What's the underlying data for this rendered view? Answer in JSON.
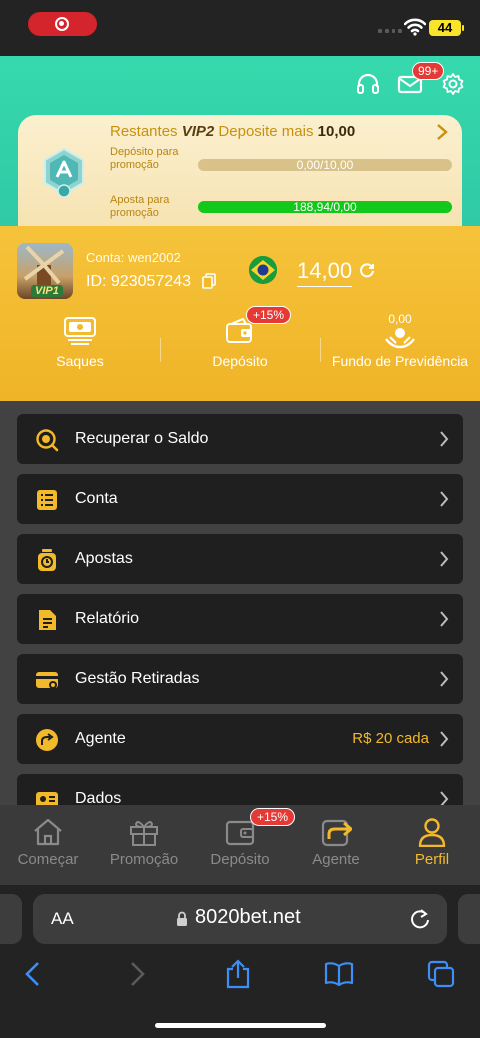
{
  "status": {
    "battery": "44"
  },
  "header": {
    "mail_badge": "99+"
  },
  "vip": {
    "prefix": "Restantes",
    "level": "VIP2",
    "middle": "Deposite mais",
    "amount": "10,00",
    "deposit_label": "Depósito para promoção",
    "deposit_progress": "0,00/10,00",
    "deposit_fraction": 0,
    "bet_label": "Aposta para promoção",
    "bet_progress": "188,94/0,00",
    "bet_fraction": 1,
    "avatar_tag": "VIP1"
  },
  "account": {
    "conta_label": "Conta:",
    "username": "wen2002",
    "id_label": "ID:",
    "id": "923057243",
    "balance": "14,00"
  },
  "quick_actions": {
    "saques": "Saques",
    "deposito": "Depósito",
    "deposito_badge": "+15%",
    "fundo": "Fundo de Previdência",
    "fundo_value": "0,00"
  },
  "menu": [
    {
      "label": "Recuperar o Saldo",
      "icon": "search-coin-icon"
    },
    {
      "label": "Conta",
      "icon": "list-icon"
    },
    {
      "label": "Apostas",
      "icon": "clock-icon"
    },
    {
      "label": "Relatório",
      "icon": "document-icon"
    },
    {
      "label": "Gestão Retiradas",
      "icon": "card-icon"
    },
    {
      "label": "Agente",
      "icon": "share-icon",
      "extra": "R$ 20 cada"
    },
    {
      "label": "Dados",
      "icon": "id-card-icon"
    }
  ],
  "bottom_nav": {
    "comecar": "Começar",
    "promocao": "Promoção",
    "deposito": "Depósito",
    "deposito_badge": "+15%",
    "agente": "Agente",
    "perfil": "Perfil"
  },
  "browser": {
    "aa": "AA",
    "url": "8020bet.net"
  },
  "colors": {
    "teal": "#36d9ad",
    "yellow": "#f5c33a",
    "accent": "#f2b92a",
    "progress_green": "#12c81a"
  }
}
